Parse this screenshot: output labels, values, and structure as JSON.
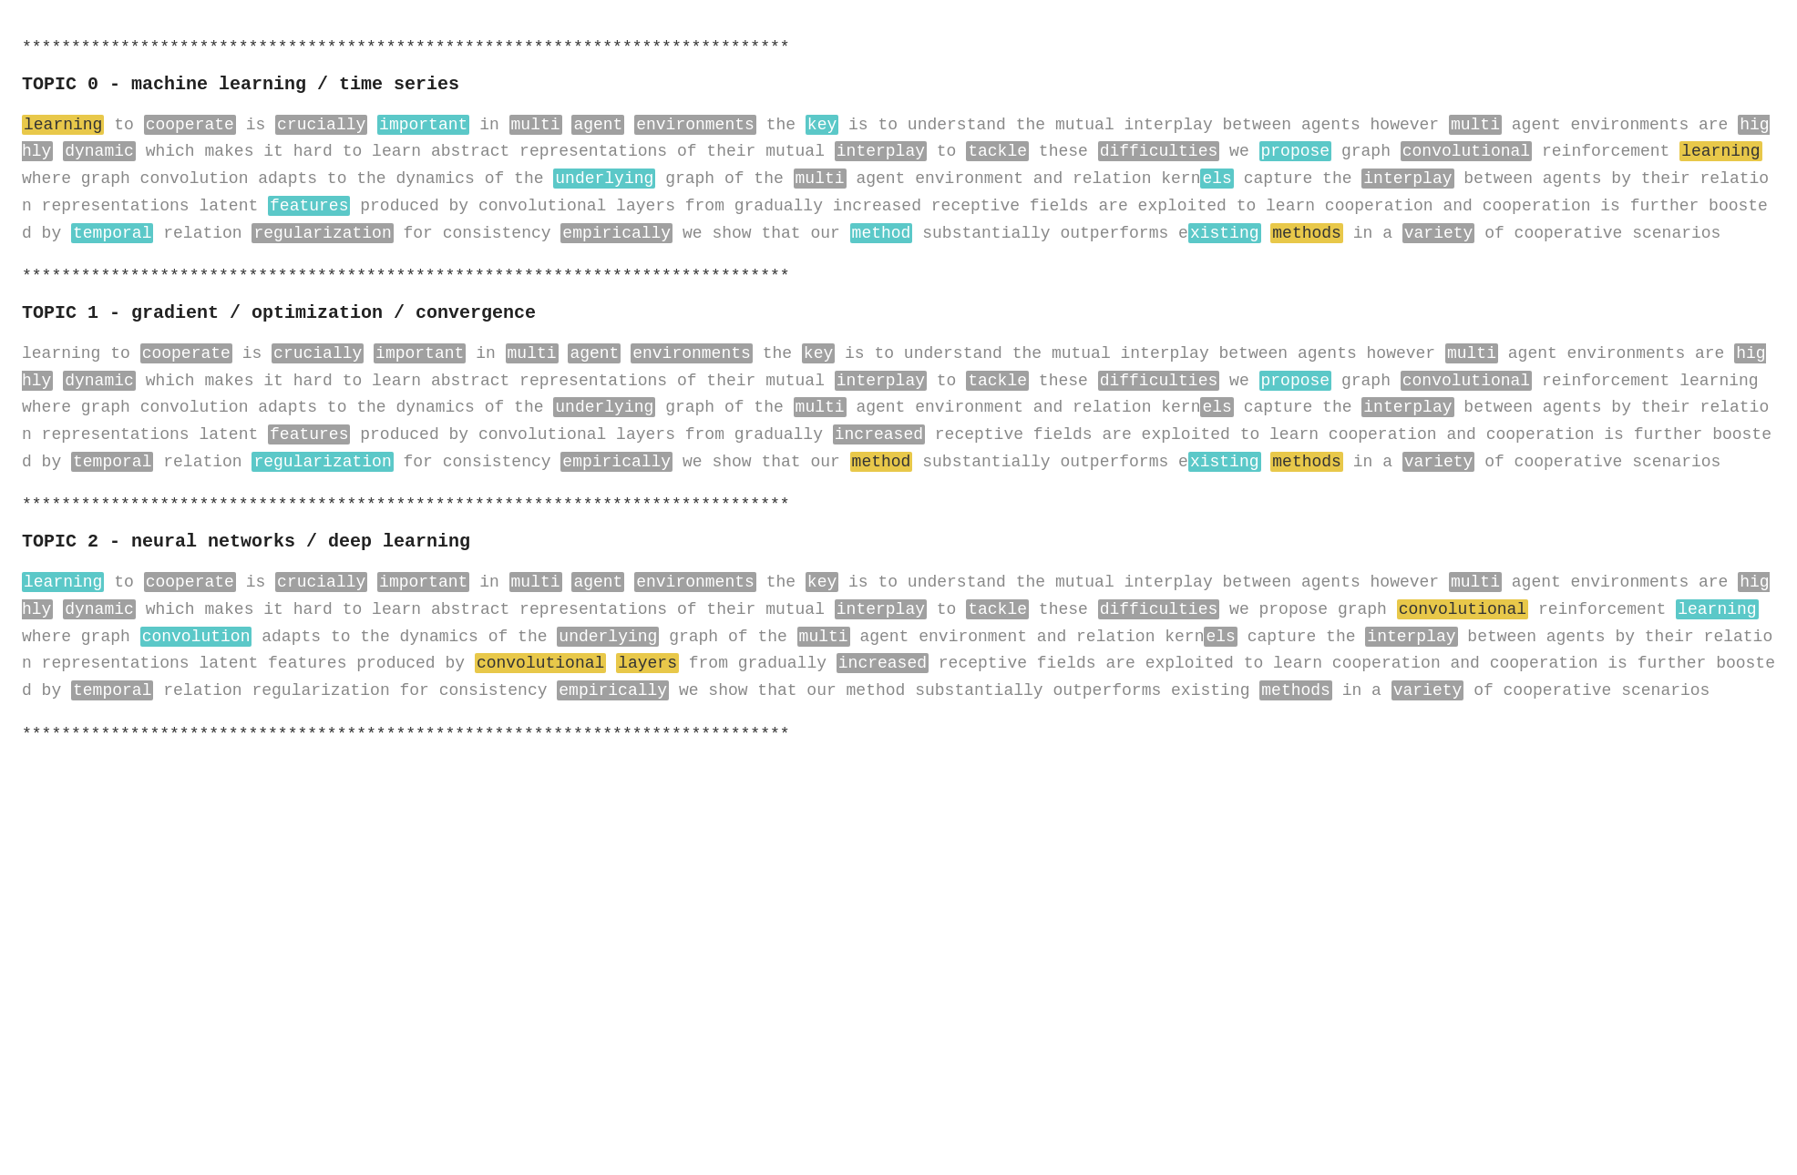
{
  "dividers": {
    "stars": "******************************************************************************"
  },
  "topics": [
    {
      "id": 0,
      "title": "TOPIC 0 - machine learning / time series",
      "paragraphs": [
        {
          "words": [
            {
              "text": "learning",
              "style": "hl-yellow"
            },
            {
              "text": " to ",
              "style": "plain"
            },
            {
              "text": "cooperate",
              "style": "hl-gray"
            },
            {
              "text": " is ",
              "style": "plain"
            },
            {
              "text": "crucially",
              "style": "hl-gray"
            },
            {
              "text": " ",
              "style": "plain"
            },
            {
              "text": "important",
              "style": "hl-teal"
            },
            {
              "text": " in ",
              "style": "plain"
            },
            {
              "text": "multi",
              "style": "hl-gray"
            },
            {
              "text": " ",
              "style": "plain"
            },
            {
              "text": "agent",
              "style": "hl-gray"
            },
            {
              "text": " ",
              "style": "plain"
            },
            {
              "text": "environments",
              "style": "hl-gray"
            },
            {
              "text": " the ",
              "style": "plain"
            },
            {
              "text": "key",
              "style": "hl-teal"
            },
            {
              "text": " is to understand the mutual interplay between agents however ",
              "style": "plain"
            },
            {
              "text": "multi",
              "style": "hl-gray"
            },
            {
              "text": " agent environments are ",
              "style": "plain"
            },
            {
              "text": "highly",
              "style": "hl-gray"
            },
            {
              "text": " ",
              "style": "plain"
            },
            {
              "text": "dynamic",
              "style": "hl-gray"
            },
            {
              "text": " which makes it hard to learn abstract representations of their mutual ",
              "style": "plain"
            },
            {
              "text": "interplay",
              "style": "hl-gray"
            },
            {
              "text": " to ",
              "style": "plain"
            },
            {
              "text": "tackle",
              "style": "hl-gray"
            },
            {
              "text": " these ",
              "style": "plain"
            },
            {
              "text": "difficulties",
              "style": "hl-gray"
            },
            {
              "text": " we ",
              "style": "plain"
            },
            {
              "text": "propose",
              "style": "hl-teal"
            },
            {
              "text": " graph ",
              "style": "plain"
            },
            {
              "text": "convolutional",
              "style": "hl-gray"
            },
            {
              "text": " reinforcement ",
              "style": "plain"
            },
            {
              "text": "learning",
              "style": "hl-yellow"
            },
            {
              "text": " where graph convolution adapts to the dynamics of the ",
              "style": "plain"
            },
            {
              "text": "underlying",
              "style": "hl-teal"
            },
            {
              "text": " graph of the ",
              "style": "plain"
            },
            {
              "text": "multi",
              "style": "hl-gray"
            },
            {
              "text": " agent environment and relation kern",
              "style": "plain"
            },
            {
              "text": "els",
              "style": "hl-teal"
            },
            {
              "text": " capture the ",
              "style": "plain"
            },
            {
              "text": "interplay",
              "style": "hl-gray"
            },
            {
              "text": " between agents by their relation representations latent ",
              "style": "plain"
            },
            {
              "text": "features",
              "style": "hl-teal"
            },
            {
              "text": " produced by convolutional layers from gradually increased receptive fields are exploited to learn cooperation and cooperation is further boosted by ",
              "style": "plain"
            },
            {
              "text": "temporal",
              "style": "hl-teal"
            },
            {
              "text": " relation ",
              "style": "plain"
            },
            {
              "text": "regularization",
              "style": "hl-gray"
            },
            {
              "text": " for consistency ",
              "style": "plain"
            },
            {
              "text": "empirically",
              "style": "hl-gray"
            },
            {
              "text": " we show that our ",
              "style": "plain"
            },
            {
              "text": "method",
              "style": "hl-teal"
            },
            {
              "text": " substantially outperforms e",
              "style": "plain"
            },
            {
              "text": "xisting",
              "style": "hl-teal"
            },
            {
              "text": " ",
              "style": "plain"
            },
            {
              "text": "methods",
              "style": "hl-yellow"
            },
            {
              "text": " in a ",
              "style": "plain"
            },
            {
              "text": "variety",
              "style": "hl-gray"
            },
            {
              "text": " of cooperative scenarios",
              "style": "plain"
            }
          ]
        }
      ]
    },
    {
      "id": 1,
      "title": "TOPIC 1 - gradient / optimization / convergence",
      "paragraphs": [
        {
          "words": [
            {
              "text": "learning",
              "style": "plain"
            },
            {
              "text": " to ",
              "style": "plain"
            },
            {
              "text": "cooperate",
              "style": "hl-gray"
            },
            {
              "text": " is ",
              "style": "plain"
            },
            {
              "text": "crucially",
              "style": "hl-gray"
            },
            {
              "text": " ",
              "style": "plain"
            },
            {
              "text": "important",
              "style": "hl-gray"
            },
            {
              "text": " in ",
              "style": "plain"
            },
            {
              "text": "multi",
              "style": "hl-gray"
            },
            {
              "text": " ",
              "style": "plain"
            },
            {
              "text": "agent",
              "style": "hl-gray"
            },
            {
              "text": " ",
              "style": "plain"
            },
            {
              "text": "environments",
              "style": "hl-gray"
            },
            {
              "text": " the ",
              "style": "plain"
            },
            {
              "text": "key",
              "style": "hl-gray"
            },
            {
              "text": " is to understand the mutual interplay between agents however ",
              "style": "plain"
            },
            {
              "text": "multi",
              "style": "hl-gray"
            },
            {
              "text": " agent environments are ",
              "style": "plain"
            },
            {
              "text": "highly",
              "style": "hl-gray"
            },
            {
              "text": " ",
              "style": "plain"
            },
            {
              "text": "dynamic",
              "style": "hl-gray"
            },
            {
              "text": " which makes it hard to learn abstract representations of their mutual ",
              "style": "plain"
            },
            {
              "text": "interplay",
              "style": "hl-gray"
            },
            {
              "text": " to ",
              "style": "plain"
            },
            {
              "text": "tackle",
              "style": "hl-gray"
            },
            {
              "text": " these ",
              "style": "plain"
            },
            {
              "text": "difficulties",
              "style": "hl-gray"
            },
            {
              "text": " we ",
              "style": "plain"
            },
            {
              "text": "propose",
              "style": "hl-teal"
            },
            {
              "text": " graph ",
              "style": "plain"
            },
            {
              "text": "convolutional",
              "style": "hl-gray"
            },
            {
              "text": " reinforcement learning wh",
              "style": "plain"
            },
            {
              "text": "ere graph convolution adapts to the dynamics of the ",
              "style": "plain"
            },
            {
              "text": "underlying",
              "style": "hl-gray"
            },
            {
              "text": " graph of the ",
              "style": "plain"
            },
            {
              "text": "multi",
              "style": "hl-gray"
            },
            {
              "text": " agent environment and relation kern",
              "style": "plain"
            },
            {
              "text": "els",
              "style": "hl-gray"
            },
            {
              "text": " capture the ",
              "style": "plain"
            },
            {
              "text": "interplay",
              "style": "hl-gray"
            },
            {
              "text": " between agents by their relation representations latent ",
              "style": "plain"
            },
            {
              "text": "features",
              "style": "hl-gray"
            },
            {
              "text": " produced by convolutional layers from gradually ",
              "style": "plain"
            },
            {
              "text": "increased",
              "style": "hl-gray"
            },
            {
              "text": " receptive fields are exploited to learn cooperation and cooperation is further boosted by ",
              "style": "plain"
            },
            {
              "text": "temporal",
              "style": "hl-gray"
            },
            {
              "text": " relation ",
              "style": "plain"
            },
            {
              "text": "regularization",
              "style": "hl-teal"
            },
            {
              "text": " for consistency ",
              "style": "plain"
            },
            {
              "text": "empirically",
              "style": "hl-gray"
            },
            {
              "text": " we show that our ",
              "style": "plain"
            },
            {
              "text": "method",
              "style": "hl-yellow"
            },
            {
              "text": " substantially outperforms e",
              "style": "plain"
            },
            {
              "text": "xisting",
              "style": "hl-teal"
            },
            {
              "text": " ",
              "style": "plain"
            },
            {
              "text": "methods",
              "style": "hl-yellow"
            },
            {
              "text": " in a ",
              "style": "plain"
            },
            {
              "text": "variety",
              "style": "hl-gray"
            },
            {
              "text": " of cooperative scenarios",
              "style": "plain"
            }
          ]
        }
      ]
    },
    {
      "id": 2,
      "title": "TOPIC 2 - neural networks / deep learning",
      "paragraphs": [
        {
          "words": [
            {
              "text": "learning",
              "style": "hl-teal"
            },
            {
              "text": " to ",
              "style": "plain"
            },
            {
              "text": "cooperate",
              "style": "hl-gray"
            },
            {
              "text": " is ",
              "style": "plain"
            },
            {
              "text": "crucially",
              "style": "hl-gray"
            },
            {
              "text": " ",
              "style": "plain"
            },
            {
              "text": "important",
              "style": "hl-gray"
            },
            {
              "text": " in ",
              "style": "plain"
            },
            {
              "text": "multi",
              "style": "hl-gray"
            },
            {
              "text": " ",
              "style": "plain"
            },
            {
              "text": "agent",
              "style": "hl-gray"
            },
            {
              "text": " ",
              "style": "plain"
            },
            {
              "text": "environments",
              "style": "hl-gray"
            },
            {
              "text": " the ",
              "style": "plain"
            },
            {
              "text": "key",
              "style": "hl-gray"
            },
            {
              "text": " is to understand the mutual interplay between agents however ",
              "style": "plain"
            },
            {
              "text": "multi",
              "style": "hl-gray"
            },
            {
              "text": " agent environments are ",
              "style": "plain"
            },
            {
              "text": "highly",
              "style": "hl-gray"
            },
            {
              "text": " ",
              "style": "plain"
            },
            {
              "text": "dynamic",
              "style": "hl-gray"
            },
            {
              "text": " which makes it hard to learn abstract representations of their mutual ",
              "style": "plain"
            },
            {
              "text": "interplay",
              "style": "hl-gray"
            },
            {
              "text": " to ",
              "style": "plain"
            },
            {
              "text": "tackle",
              "style": "hl-gray"
            },
            {
              "text": " these ",
              "style": "plain"
            },
            {
              "text": "difficulties",
              "style": "hl-gray"
            },
            {
              "text": " we propose graph ",
              "style": "plain"
            },
            {
              "text": "convolutional",
              "style": "hl-yellow"
            },
            {
              "text": " reinforcement ",
              "style": "plain"
            },
            {
              "text": "learning",
              "style": "hl-teal"
            },
            {
              "text": " wh",
              "style": "plain"
            },
            {
              "text": "ere graph ",
              "style": "plain"
            },
            {
              "text": "convolution",
              "style": "hl-teal"
            },
            {
              "text": " adapts to the dynamics of the ",
              "style": "plain"
            },
            {
              "text": "underlying",
              "style": "hl-gray"
            },
            {
              "text": " graph of the ",
              "style": "plain"
            },
            {
              "text": "multi",
              "style": "hl-gray"
            },
            {
              "text": " agent environment and relation kern",
              "style": "plain"
            },
            {
              "text": "els",
              "style": "hl-gray"
            },
            {
              "text": " capture the ",
              "style": "plain"
            },
            {
              "text": "interplay",
              "style": "hl-gray"
            },
            {
              "text": " between agents by their relation representations latent features produced by ",
              "style": "plain"
            },
            {
              "text": "convolutional",
              "style": "hl-yellow"
            },
            {
              "text": " ",
              "style": "plain"
            },
            {
              "text": "layers",
              "style": "hl-yellow"
            },
            {
              "text": " from gradually ",
              "style": "plain"
            },
            {
              "text": "increased",
              "style": "hl-gray"
            },
            {
              "text": " receptive fields are exploited to learn cooperation and cooperation is further boosted by ",
              "style": "plain"
            },
            {
              "text": "temporal",
              "style": "hl-gray"
            },
            {
              "text": " relation regularization for consistency ",
              "style": "plain"
            },
            {
              "text": "empirically",
              "style": "hl-gray"
            },
            {
              "text": " we show that our method substantially outperforms e",
              "style": "plain"
            },
            {
              "text": "xisting",
              "style": "plain"
            },
            {
              "text": " ",
              "style": "plain"
            },
            {
              "text": "methods",
              "style": "hl-gray"
            },
            {
              "text": " in a ",
              "style": "plain"
            },
            {
              "text": "variety",
              "style": "hl-gray"
            },
            {
              "text": " of cooperative scenarios",
              "style": "plain"
            }
          ]
        }
      ]
    }
  ]
}
